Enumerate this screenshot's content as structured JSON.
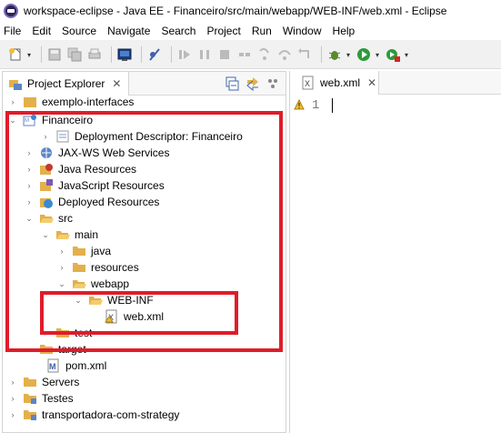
{
  "window": {
    "title": "workspace-eclipse - Java EE - Financeiro/src/main/webapp/WEB-INF/web.xml - Eclipse"
  },
  "menu": [
    "File",
    "Edit",
    "Source",
    "Navigate",
    "Search",
    "Project",
    "Run",
    "Window",
    "Help"
  ],
  "project_explorer": {
    "tab_label": "Project Explorer"
  },
  "tree": {
    "exemplo": "exemplo-interfaces",
    "financeiro": "Financeiro",
    "deployment": "Deployment Descriptor: Financeiro",
    "jaxws": "JAX-WS Web Services",
    "java_resources": "Java Resources",
    "js_resources": "JavaScript Resources",
    "deployed": "Deployed Resources",
    "src": "src",
    "main": "main",
    "java": "java",
    "resources": "resources",
    "webapp": "webapp",
    "webinf": "WEB-INF",
    "webxml": "web.xml",
    "test": "test",
    "target": "target",
    "pom": "pom.xml",
    "servers": "Servers",
    "testes": "Testes",
    "transportadora": "transportadora-com-strategy"
  },
  "editor": {
    "tab_label": "web.xml",
    "line_number": "1"
  },
  "colors": {
    "highlight": "#e01c2a",
    "folder": "#e3b04b",
    "toolbar_bg": "#f1f1f1"
  }
}
